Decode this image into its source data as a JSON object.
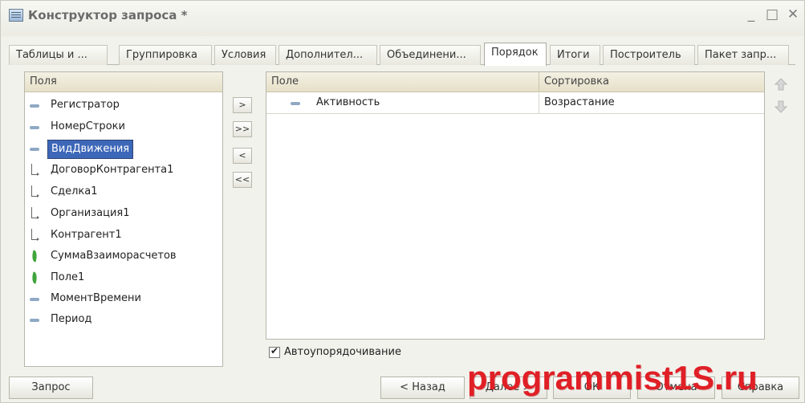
{
  "window": {
    "title": "Конструктор запроса *",
    "minimize": "_",
    "maximize": "□",
    "close": "✕"
  },
  "tabs": [
    {
      "label": "Таблицы и ..."
    },
    {
      "label": "Группировка"
    },
    {
      "label": "Условия"
    },
    {
      "label": "Дополнител..."
    },
    {
      "label": "Объединени..."
    },
    {
      "label": "Порядок",
      "active": true
    },
    {
      "label": "Итоги"
    },
    {
      "label": "Построитель"
    },
    {
      "label": "Пакет запр..."
    }
  ],
  "fields_panel": {
    "header": "Поля",
    "items": [
      {
        "icon": "dash",
        "label": "Регистратор"
      },
      {
        "icon": "dash",
        "label": "НомерСтроки"
      },
      {
        "icon": "dash",
        "label": "ВидДвижения",
        "selected": true
      },
      {
        "icon": "tree",
        "label": "ДоговорКонтрагента1"
      },
      {
        "icon": "tree",
        "label": "Сделка1"
      },
      {
        "icon": "tree",
        "label": "Организация1"
      },
      {
        "icon": "tree",
        "label": "Контрагент1"
      },
      {
        "icon": "leaf",
        "label": "СуммаВзаиморасчетов"
      },
      {
        "icon": "leaf",
        "label": "Поле1"
      },
      {
        "icon": "dash",
        "label": "МоментВремени"
      },
      {
        "icon": "dash",
        "label": "Период"
      }
    ]
  },
  "move_buttons": [
    ">",
    ">>",
    "<",
    "<<"
  ],
  "order_table": {
    "columns": [
      "Поле",
      "Сортировка"
    ],
    "rows": [
      {
        "field": "Активность",
        "sort": "Возрастание"
      }
    ]
  },
  "auto_order": {
    "label": "Автоупорядочивание",
    "checked": true
  },
  "buttons": {
    "query": "Запрос",
    "back": "< Назад",
    "next": "Далее >",
    "ok": "ОК",
    "cancel": "Отмена",
    "help": "Справка"
  },
  "watermark": "programmist1S.ru",
  "colors": {
    "selection": "#3d67b8",
    "watermark": "#e01f26",
    "header": "#e9e4cf"
  }
}
